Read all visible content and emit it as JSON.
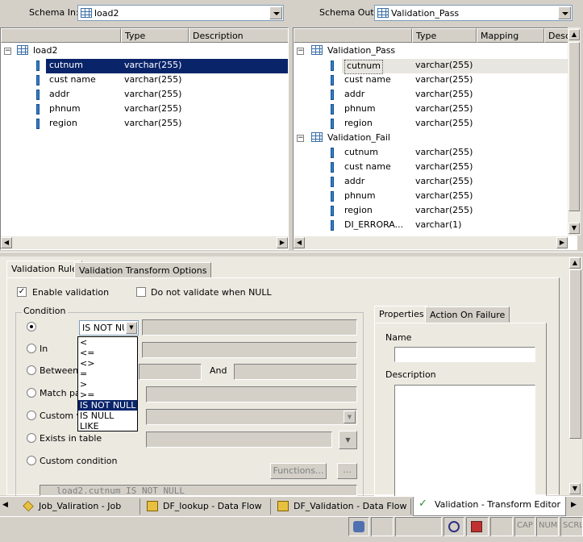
{
  "schema_in": {
    "label": "Schema In:",
    "value": "load2",
    "headers": [
      "",
      "Type",
      "Description"
    ],
    "root": "load2",
    "columns": [
      {
        "name": "cutnum",
        "type": "varchar(255)"
      },
      {
        "name": "cust name",
        "type": "varchar(255)"
      },
      {
        "name": "addr",
        "type": "varchar(255)"
      },
      {
        "name": "phnum",
        "type": "varchar(255)"
      },
      {
        "name": "region",
        "type": "varchar(255)"
      }
    ]
  },
  "schema_out": {
    "label": "Schema Out:",
    "value": "Validation_Pass",
    "headers": [
      "",
      "Type",
      "Mapping",
      "Desc"
    ],
    "groups": [
      {
        "name": "Validation_Pass",
        "columns": [
          {
            "name": "cutnum",
            "type": "varchar(255)"
          },
          {
            "name": "cust name",
            "type": "varchar(255)"
          },
          {
            "name": "addr",
            "type": "varchar(255)"
          },
          {
            "name": "phnum",
            "type": "varchar(255)"
          },
          {
            "name": "region",
            "type": "varchar(255)"
          }
        ]
      },
      {
        "name": "Validation_Fail",
        "columns": [
          {
            "name": "cutnum",
            "type": "varchar(255)"
          },
          {
            "name": "cust name",
            "type": "varchar(255)"
          },
          {
            "name": "addr",
            "type": "varchar(255)"
          },
          {
            "name": "phnum",
            "type": "varchar(255)"
          },
          {
            "name": "region",
            "type": "varchar(255)"
          },
          {
            "name": "DI_ERRORA...",
            "type": "varchar(1)"
          }
        ]
      }
    ]
  },
  "tabs": {
    "validation_rule": "Validation Rule",
    "transform_options": "Validation Transform Options"
  },
  "options": {
    "enable_validation": "Enable validation",
    "do_not_validate_null": "Do not validate when NULL"
  },
  "condition": {
    "group_label": "Condition",
    "operator_value": "IS NOT NULL",
    "operator_options": [
      "<",
      "<=",
      "<>",
      "=",
      ">",
      ">=",
      "IS NOT NULL",
      "IS NULL",
      "LIKE"
    ],
    "in": "In",
    "between": "Between",
    "and": "And",
    "match_pattern": "Match pat",
    "custom_validation": "Custom va",
    "exists_in_table": "Exists in table",
    "custom_condition": "Custom condition",
    "functions_button": "Functions...",
    "ellipsis_button": "...",
    "expression": "load2.cutnum IS NOT NULL"
  },
  "right_panel": {
    "tab_properties": "Properties",
    "tab_action": "Action On Failure",
    "name_label": "Name",
    "description_label": "Description"
  },
  "bottom_tabs": [
    {
      "label": "Job_Valiration - Job"
    },
    {
      "label": "DF_lookup - Data Flow"
    },
    {
      "label": "DF_Validation - Data Flow"
    },
    {
      "label": "Validation - Transform Editor"
    }
  ],
  "status": {
    "cap": "CAP",
    "num": "NUM",
    "scrl": "SCRL"
  }
}
